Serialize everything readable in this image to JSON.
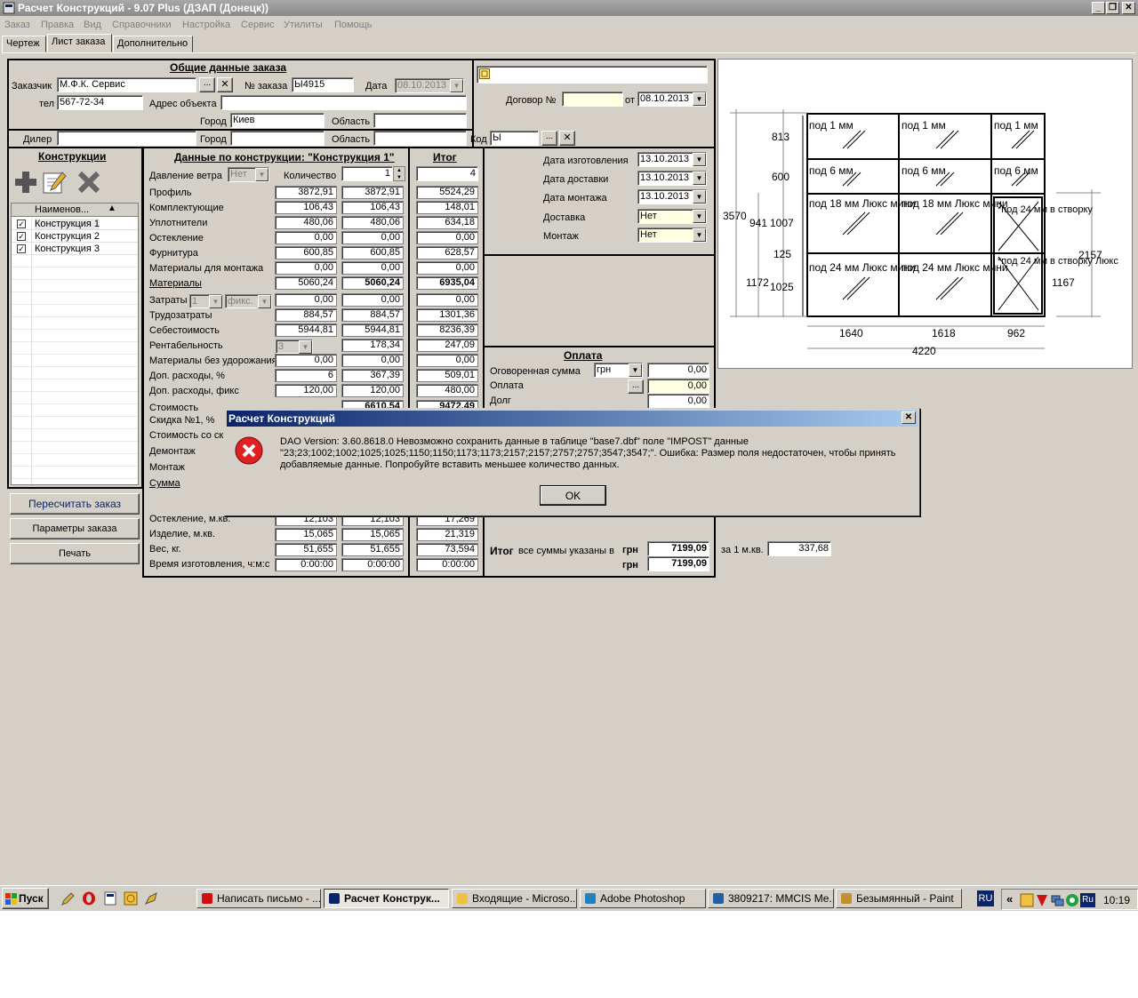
{
  "window": {
    "title": "Расчет Конструкций - 9.07 Plus (ДЗАП (Донецк))"
  },
  "menu": [
    "Заказ",
    "Правка",
    "Вид",
    "Справочники",
    "Настройка",
    "Сервис",
    "Утилиты",
    "Помощь"
  ],
  "tabs": [
    "Чертеж",
    "Лист заказа",
    "Дополнительно"
  ],
  "order": {
    "header": "Общие данные заказа",
    "customer_label": "Заказчик",
    "customer": "М.Ф.К. Сервис",
    "order_no_label": "№ заказа",
    "order_no": "Ы4915",
    "date_label": "Дата",
    "date": "08.10.2013",
    "phone_label": "тел",
    "phone": "567-72-34",
    "address_label": "Адрес объекта",
    "address": "",
    "city_label": "Город",
    "city": "Киев",
    "region_label": "Область",
    "region": "",
    "dealer_label": "Дилер",
    "dealer": "",
    "city2": "",
    "region2": "",
    "code_label": "Код",
    "code": "Ы",
    "contract_label": "Договор №",
    "contract": "",
    "from_label": "от",
    "contract_date": "08.10.2013"
  },
  "constructions": {
    "header": "Конструкции",
    "col_header": "Наименов...",
    "items": [
      "Конструкция 1",
      "Конструкция 2",
      "Конструкция 3"
    ]
  },
  "data": {
    "header": "Данные по конструкции: \"Конструкция 1\"",
    "total_header": "Итог",
    "wind_label": "Давление ветра",
    "wind": "Нет",
    "qty_label": "Количество",
    "qty": "1",
    "qty_total": "4",
    "rows": [
      {
        "label": "Профиль",
        "a": "3872,91",
        "b": "3872,91",
        "t": "5524,29"
      },
      {
        "label": "Комплектующие",
        "a": "106,43",
        "b": "106,43",
        "t": "148,01"
      },
      {
        "label": "Уплотнители",
        "a": "480,06",
        "b": "480,06",
        "t": "634,18"
      },
      {
        "label": "Остекление",
        "a": "0,00",
        "b": "0,00",
        "t": "0,00"
      },
      {
        "label": "Фурнитура",
        "a": "600,85",
        "b": "600,85",
        "t": "628,57"
      },
      {
        "label": "Материалы для монтажа",
        "a": "0,00",
        "b": "0,00",
        "t": "0,00"
      },
      {
        "label": "Материалы",
        "a": "5060,24",
        "b": "5060,24",
        "t": "6935,04"
      },
      {
        "label": "Затраты",
        "a": "0,00",
        "b": "0,00",
        "t": "0,00"
      },
      {
        "label": "Трудозатраты",
        "a": "884,57",
        "b": "884,57",
        "t": "1301,36"
      },
      {
        "label": "Себестоимость",
        "a": "5944,81",
        "b": "5944,81",
        "t": "8236,39"
      },
      {
        "label": "Рентабельность",
        "a": "",
        "b": "178,34",
        "t": "247,09"
      },
      {
        "label": "Материалы без удорожания",
        "a": "0,00",
        "b": "0,00",
        "t": "0,00"
      },
      {
        "label": "Доп. расходы, %",
        "a": "6",
        "b": "367,39",
        "t": "509,01"
      },
      {
        "label": "Доп. расходы, фикс",
        "a": "120,00",
        "b": "120,00",
        "t": "480,00"
      }
    ],
    "costs_count": "1",
    "costs_type": "фикс.",
    "rent_value": "3",
    "cost_label": "Стоимость",
    "cost_b": "6610,54",
    "cost_t": "9472,49",
    "discount_label": "Скидка №1, %",
    "cost_disc_label": "Стоимость со ск",
    "dismantle_label": "Демонтаж",
    "mount_label": "Монтаж",
    "sum_label": "Сумма",
    "bottom_rows": [
      {
        "label": "Остекление, м.кв.",
        "a": "12,103",
        "b": "12,103",
        "t": "17,269"
      },
      {
        "label": "Изделие, м.кв.",
        "a": "15,065",
        "b": "15,065",
        "t": "21,319"
      },
      {
        "label": "Вес, кг.",
        "a": "51,655",
        "b": "51,655",
        "t": "73,594"
      },
      {
        "label": "Время изготовления, ч:м:с",
        "a": "0:00:00",
        "b": "0:00:00",
        "t": "0:00:00"
      }
    ]
  },
  "dates": {
    "made_label": "Дата изготовления",
    "made": "13.10.2013",
    "delivery_label": "Дата доставки",
    "delivery": "13.10.2013",
    "mount_label": "Дата монтажа",
    "mount": "13.10.2013",
    "ship_label": "Доставка",
    "ship": "Нет",
    "install_label": "Монтаж",
    "install": "Нет"
  },
  "payment": {
    "header": "Оплата",
    "agreed_label": "Оговоренная сумма",
    "currency": "грн",
    "agreed": "0,00",
    "paid_label": "Оплата",
    "paid": "0,00",
    "debt_label": "Долг",
    "debt": "0,00",
    "total_label": "Итог",
    "total_note": "все суммы указаны в",
    "cur1": "грн",
    "total1": "7199,09",
    "cur2": "грн",
    "total2": "7199,09",
    "per_m2_label": "за 1 м.кв.",
    "per_m2": "337,68"
  },
  "buttons": {
    "recalc": "Пересчитать заказ",
    "params": "Параметры заказа",
    "print": "Печать"
  },
  "drawing": {
    "cells": [
      "под 1 мм",
      "под 1 мм",
      "под 1 мм",
      "под 6 мм",
      "под 6 мм",
      "под 6 мм",
      "под 18 мм Люкс мини",
      "под 18 мм Люкс мини",
      "*под 24 мм в створку",
      "под 24 мм Люкс мини",
      "под 24 мм Люкс мини",
      "*под 24 мм в створку Люкс"
    ],
    "dims": [
      "813",
      "600",
      "3570",
      "941",
      "1007",
      "125",
      "1172",
      "1025",
      "2157",
      "1167",
      "1640",
      "1618",
      "962",
      "4220"
    ]
  },
  "dialog": {
    "title": "Расчет Конструкций",
    "line1": "DAO Version: 3.60.8618.0 Невозможно сохранить данные в таблице \"base7.dbf\" поле \"IMPOST\" данные",
    "line2": "\"23;23;1002;1002;1025;1025;1150;1150;1173;1173;2157;2157;2757;2757;3547;3547;\". Ошибка: Размер поля недостаточен, чтобы принять",
    "line3": "добавляемые данные.  Попробуйте вставить меньшее количество данных.",
    "ok": "OK"
  },
  "taskbar": {
    "start": "Пуск",
    "items": [
      "Написать письмо - ...",
      "Расчет Конструк...",
      "Входящие - Microso...",
      "Adobe Photoshop",
      "3809217: MMCIS Me...",
      "Безымянный - Paint"
    ],
    "lang": "RU",
    "time": "10:19"
  }
}
